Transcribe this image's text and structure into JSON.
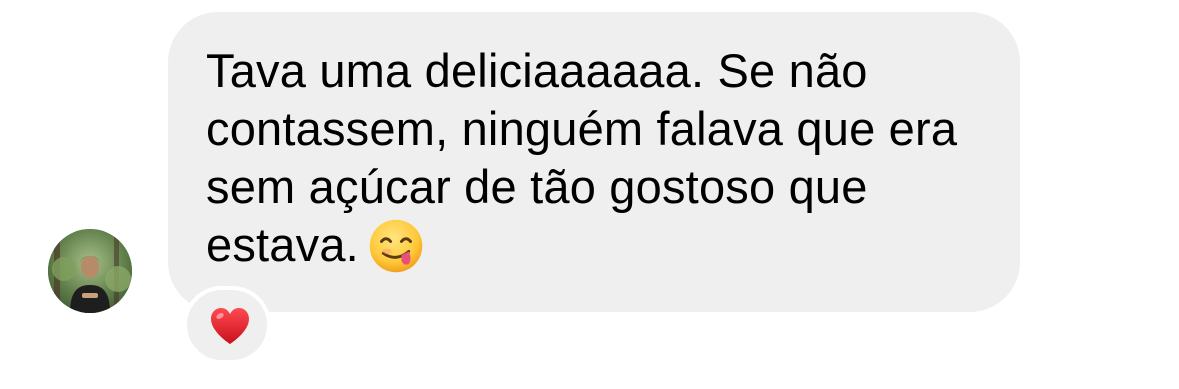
{
  "message": {
    "lines": [
      "Tava uma deliciaaaaaa. Se não",
      "contassem, ninguém falava que era",
      "sem açúcar de tão gostoso que",
      "estava."
    ],
    "emoji": "face-savoring-food-icon"
  },
  "reaction": {
    "emoji": "heart-icon",
    "color": "#e0202b"
  },
  "sender": {
    "avatar": "avatar"
  },
  "colors": {
    "bubble_bg": "#efefef",
    "text": "#000000"
  }
}
